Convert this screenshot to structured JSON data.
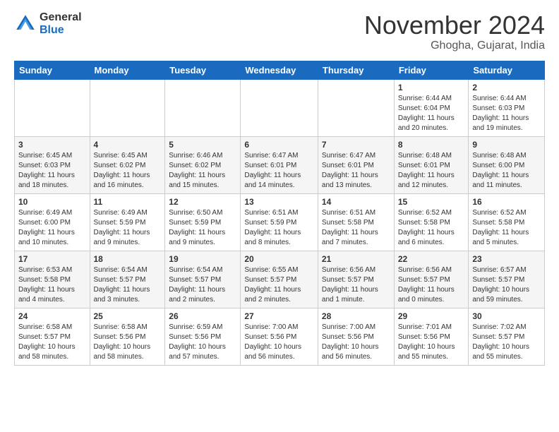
{
  "header": {
    "logo_general": "General",
    "logo_blue": "Blue",
    "title": "November 2024",
    "location": "Ghogha, Gujarat, India"
  },
  "weekdays": [
    "Sunday",
    "Monday",
    "Tuesday",
    "Wednesday",
    "Thursday",
    "Friday",
    "Saturday"
  ],
  "weeks": [
    [
      {
        "day": "",
        "info": ""
      },
      {
        "day": "",
        "info": ""
      },
      {
        "day": "",
        "info": ""
      },
      {
        "day": "",
        "info": ""
      },
      {
        "day": "",
        "info": ""
      },
      {
        "day": "1",
        "info": "Sunrise: 6:44 AM\nSunset: 6:04 PM\nDaylight: 11 hours\nand 20 minutes."
      },
      {
        "day": "2",
        "info": "Sunrise: 6:44 AM\nSunset: 6:03 PM\nDaylight: 11 hours\nand 19 minutes."
      }
    ],
    [
      {
        "day": "3",
        "info": "Sunrise: 6:45 AM\nSunset: 6:03 PM\nDaylight: 11 hours\nand 18 minutes."
      },
      {
        "day": "4",
        "info": "Sunrise: 6:45 AM\nSunset: 6:02 PM\nDaylight: 11 hours\nand 16 minutes."
      },
      {
        "day": "5",
        "info": "Sunrise: 6:46 AM\nSunset: 6:02 PM\nDaylight: 11 hours\nand 15 minutes."
      },
      {
        "day": "6",
        "info": "Sunrise: 6:47 AM\nSunset: 6:01 PM\nDaylight: 11 hours\nand 14 minutes."
      },
      {
        "day": "7",
        "info": "Sunrise: 6:47 AM\nSunset: 6:01 PM\nDaylight: 11 hours\nand 13 minutes."
      },
      {
        "day": "8",
        "info": "Sunrise: 6:48 AM\nSunset: 6:01 PM\nDaylight: 11 hours\nand 12 minutes."
      },
      {
        "day": "9",
        "info": "Sunrise: 6:48 AM\nSunset: 6:00 PM\nDaylight: 11 hours\nand 11 minutes."
      }
    ],
    [
      {
        "day": "10",
        "info": "Sunrise: 6:49 AM\nSunset: 6:00 PM\nDaylight: 11 hours\nand 10 minutes."
      },
      {
        "day": "11",
        "info": "Sunrise: 6:49 AM\nSunset: 5:59 PM\nDaylight: 11 hours\nand 9 minutes."
      },
      {
        "day": "12",
        "info": "Sunrise: 6:50 AM\nSunset: 5:59 PM\nDaylight: 11 hours\nand 9 minutes."
      },
      {
        "day": "13",
        "info": "Sunrise: 6:51 AM\nSunset: 5:59 PM\nDaylight: 11 hours\nand 8 minutes."
      },
      {
        "day": "14",
        "info": "Sunrise: 6:51 AM\nSunset: 5:58 PM\nDaylight: 11 hours\nand 7 minutes."
      },
      {
        "day": "15",
        "info": "Sunrise: 6:52 AM\nSunset: 5:58 PM\nDaylight: 11 hours\nand 6 minutes."
      },
      {
        "day": "16",
        "info": "Sunrise: 6:52 AM\nSunset: 5:58 PM\nDaylight: 11 hours\nand 5 minutes."
      }
    ],
    [
      {
        "day": "17",
        "info": "Sunrise: 6:53 AM\nSunset: 5:58 PM\nDaylight: 11 hours\nand 4 minutes."
      },
      {
        "day": "18",
        "info": "Sunrise: 6:54 AM\nSunset: 5:57 PM\nDaylight: 11 hours\nand 3 minutes."
      },
      {
        "day": "19",
        "info": "Sunrise: 6:54 AM\nSunset: 5:57 PM\nDaylight: 11 hours\nand 2 minutes."
      },
      {
        "day": "20",
        "info": "Sunrise: 6:55 AM\nSunset: 5:57 PM\nDaylight: 11 hours\nand 2 minutes."
      },
      {
        "day": "21",
        "info": "Sunrise: 6:56 AM\nSunset: 5:57 PM\nDaylight: 11 hours\nand 1 minute."
      },
      {
        "day": "22",
        "info": "Sunrise: 6:56 AM\nSunset: 5:57 PM\nDaylight: 11 hours\nand 0 minutes."
      },
      {
        "day": "23",
        "info": "Sunrise: 6:57 AM\nSunset: 5:57 PM\nDaylight: 10 hours\nand 59 minutes."
      }
    ],
    [
      {
        "day": "24",
        "info": "Sunrise: 6:58 AM\nSunset: 5:57 PM\nDaylight: 10 hours\nand 58 minutes."
      },
      {
        "day": "25",
        "info": "Sunrise: 6:58 AM\nSunset: 5:56 PM\nDaylight: 10 hours\nand 58 minutes."
      },
      {
        "day": "26",
        "info": "Sunrise: 6:59 AM\nSunset: 5:56 PM\nDaylight: 10 hours\nand 57 minutes."
      },
      {
        "day": "27",
        "info": "Sunrise: 7:00 AM\nSunset: 5:56 PM\nDaylight: 10 hours\nand 56 minutes."
      },
      {
        "day": "28",
        "info": "Sunrise: 7:00 AM\nSunset: 5:56 PM\nDaylight: 10 hours\nand 56 minutes."
      },
      {
        "day": "29",
        "info": "Sunrise: 7:01 AM\nSunset: 5:56 PM\nDaylight: 10 hours\nand 55 minutes."
      },
      {
        "day": "30",
        "info": "Sunrise: 7:02 AM\nSunset: 5:57 PM\nDaylight: 10 hours\nand 55 minutes."
      }
    ]
  ]
}
